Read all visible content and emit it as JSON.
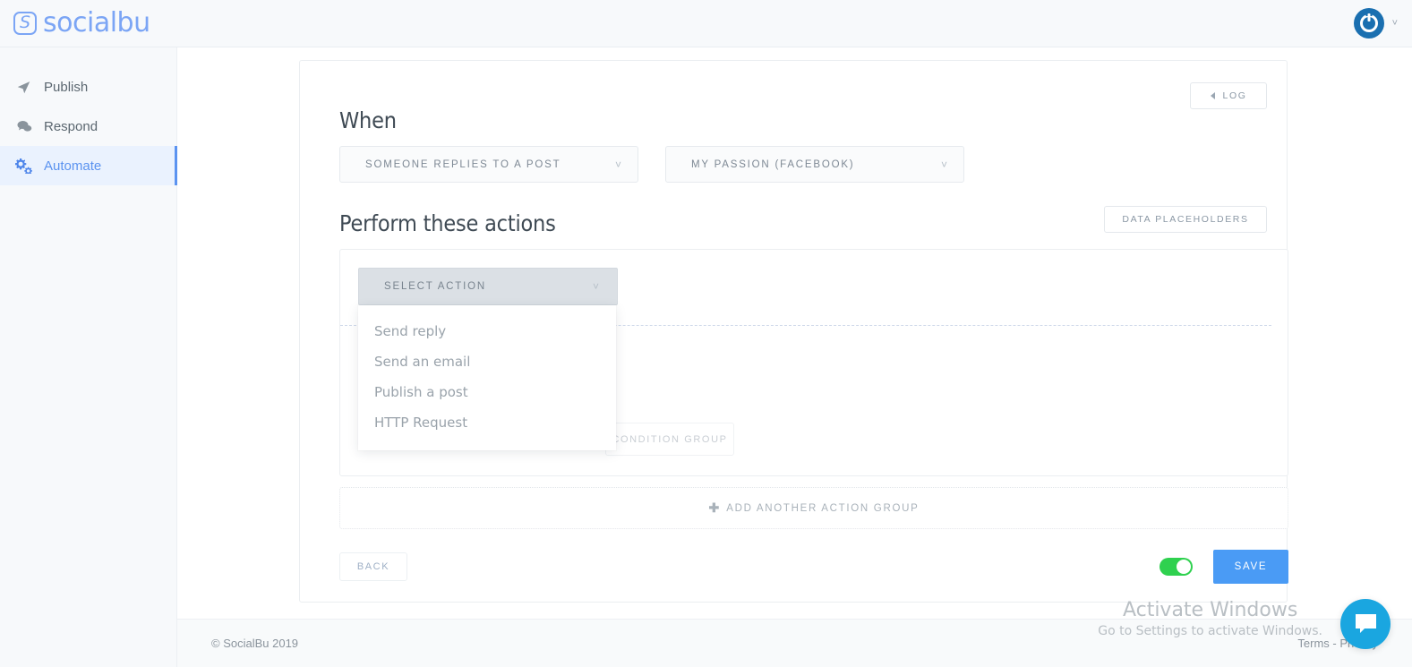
{
  "brand": {
    "mark_letter": "S",
    "name": "socialbu"
  },
  "topbar": {
    "avatar_icon": "power-circle-avatar-icon",
    "caret_icon": "chevron-down-icon"
  },
  "sidebar": {
    "items": [
      {
        "label": "Publish",
        "icon": "paper-plane-icon",
        "active": false
      },
      {
        "label": "Respond",
        "icon": "comments-icon",
        "active": false
      },
      {
        "label": "Automate",
        "icon": "cogs-icon",
        "active": true
      }
    ]
  },
  "main": {
    "log_button": "LOG",
    "when_title": "When",
    "trigger_select": {
      "value": "SOMEONE REPLIES TO A POST",
      "chevron": "chevron-down-icon"
    },
    "account_select": {
      "value": "MY PASSION (FACEBOOK)",
      "chevron": "chevron-down-icon"
    },
    "actions_title": "Perform these actions",
    "data_placeholders_button": "DATA PLACEHOLDERS",
    "select_action": {
      "value": "SELECT ACTION",
      "chevron": "chevron-down-icon",
      "open": true
    },
    "action_dropdown_options": [
      "Send reply",
      "Send an email",
      "Publish a post",
      "HTTP Request"
    ],
    "condition_group_button": "CONDITION GROUP",
    "add_action_group_button": "ADD ANOTHER ACTION GROUP",
    "add_icon": "plus-icon",
    "back_button": "BACK",
    "save_button": "SAVE",
    "enabled_toggle": {
      "state": "on",
      "color": "#2fd14f"
    }
  },
  "footer": {
    "copyright": "© SocialBu 2019",
    "terms": "Terms",
    "separator": "-",
    "privacy": "Privacy"
  },
  "watermark": {
    "line1": "Activate Windows",
    "line2": "Go to Settings to activate Windows."
  },
  "chat": {
    "icon": "chat-bubble-icon"
  },
  "colors": {
    "brand_blue": "#7ba5f5",
    "accent_blue": "#4a9bf5",
    "nav_active_bg": "#eaf2fe",
    "nav_active_text": "#5b93f0",
    "toggle_green": "#2fd14f",
    "chat_cyan": "#1aa6e0",
    "avatar_blue": "#1a6fb0"
  }
}
